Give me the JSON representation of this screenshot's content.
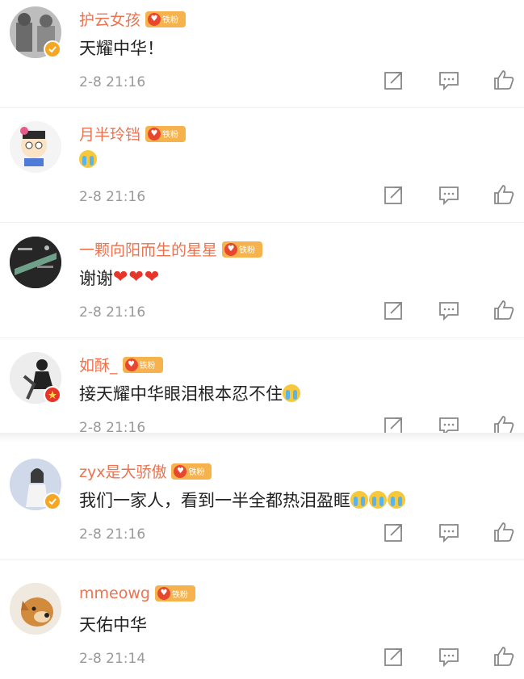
{
  "badge_label": "铁粉",
  "comments": [
    {
      "username": "护云女孩",
      "text": "天耀中华！",
      "emoji": "",
      "hearts": 0,
      "time": "2-8 21:16"
    },
    {
      "username": "月半玲铛",
      "text": "",
      "emoji": "cry",
      "emoji_count": 1,
      "hearts": 0,
      "time": "2-8 21:16"
    },
    {
      "username": "一颗向阳而生的星星",
      "text": "谢谢",
      "emoji": "",
      "hearts": 3,
      "time": "2-8 21:16"
    },
    {
      "username": "如酥_",
      "text": "接天耀中华眼泪根本忍不住",
      "emoji": "cry",
      "emoji_count": 1,
      "hearts": 0,
      "time": "2-8 21:16"
    },
    {
      "username": "zyx是大骄傲",
      "text": "我们一家人，看到一半全都热泪盈眶",
      "emoji": "cry",
      "emoji_count": 3,
      "hearts": 0,
      "time": "2-8 21:16"
    },
    {
      "username": "mmeowg",
      "text": "天佑中华",
      "emoji": "",
      "hearts": 0,
      "time": "2-8 21:14"
    }
  ],
  "colors": {
    "username": "#eb7350",
    "badge": "#f6b24d",
    "heart": "#e8352a",
    "verified": "#f5a623",
    "verified_red": "#e8352a"
  },
  "icons": {
    "share": "share-icon",
    "comment": "comment-icon",
    "like": "like-icon",
    "cry": "crying-emoji-icon",
    "heart": "red-heart-icon"
  }
}
